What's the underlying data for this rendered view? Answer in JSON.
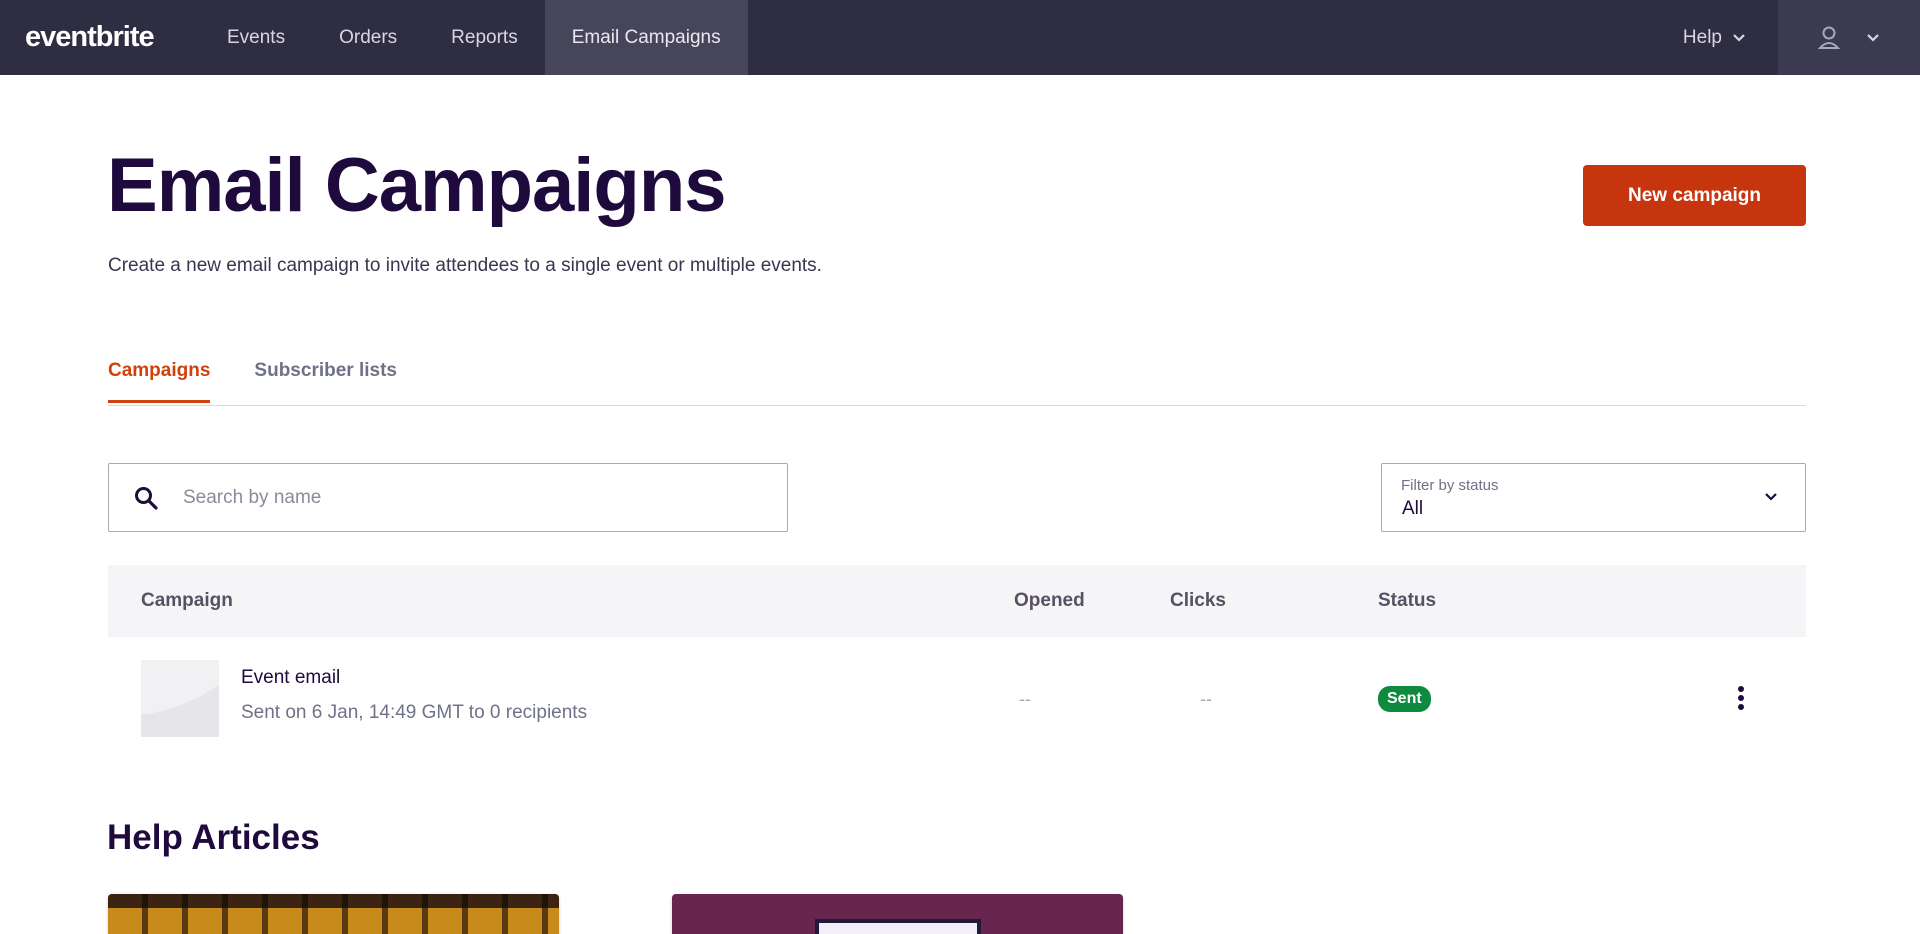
{
  "nav": {
    "logo": "eventbrite",
    "items": [
      "Events",
      "Orders",
      "Reports",
      "Email Campaigns"
    ],
    "active": "Email Campaigns",
    "help": "Help"
  },
  "header": {
    "title": "Email Campaigns",
    "subtitle": "Create a new email campaign to invite attendees to a single event or multiple events.",
    "new_button": "New campaign"
  },
  "tabs": [
    "Campaigns",
    "Subscriber lists"
  ],
  "search": {
    "placeholder": "Search by name"
  },
  "filter": {
    "label": "Filter by status",
    "value": "All"
  },
  "table": {
    "columns": [
      "Campaign",
      "Opened",
      "Clicks",
      "Status"
    ],
    "rows": [
      {
        "name": "Event email",
        "meta": "Sent on 6 Jan, 14:49 GMT to 0 recipients",
        "opened": "--",
        "clicks": "--",
        "status": "Sent"
      }
    ]
  },
  "help_articles": {
    "title": "Help Articles"
  },
  "colors": {
    "nav_bg": "#2f2d42",
    "accent": "#d1410c",
    "button": "#c7350f",
    "sent": "#0f8a3e"
  }
}
